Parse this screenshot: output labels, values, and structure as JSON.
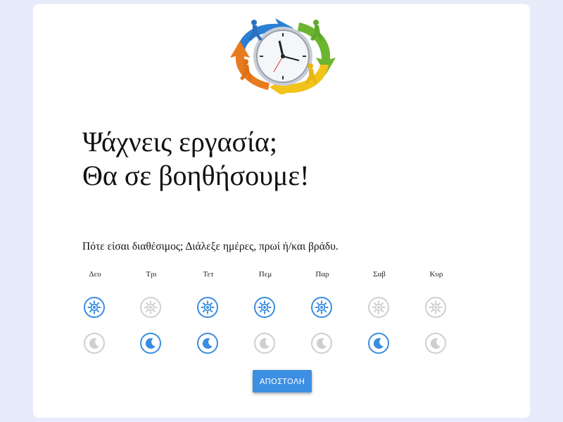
{
  "header": {
    "logo_icon": "clock-with-running-people-icon"
  },
  "headline": {
    "line1": "Ψάχνεις εργασία;",
    "line2": "Θα σε βοηθήσουμε!"
  },
  "availability": {
    "question": "Πότε είσαι διαθέσιμος; Διάλεξε ημέρες, πρωί ή/και βράδυ.",
    "morning_icon": "sun-icon",
    "evening_icon": "moon-icon",
    "active_color": "#3a8de0",
    "inactive_color": "#cfcfcf",
    "days": [
      {
        "label": "Δευ",
        "morning": true,
        "evening": false
      },
      {
        "label": "Τρι",
        "morning": false,
        "evening": true
      },
      {
        "label": "Τετ",
        "morning": true,
        "evening": true
      },
      {
        "label": "Πεμ",
        "morning": true,
        "evening": false
      },
      {
        "label": "Παρ",
        "morning": true,
        "evening": false
      },
      {
        "label": "Σαβ",
        "morning": false,
        "evening": true
      },
      {
        "label": "Κυρ",
        "morning": false,
        "evening": false
      }
    ]
  },
  "submit": {
    "label": "ΑΠΟΣΤΟΛΗ",
    "color": "#3d8fe3"
  }
}
